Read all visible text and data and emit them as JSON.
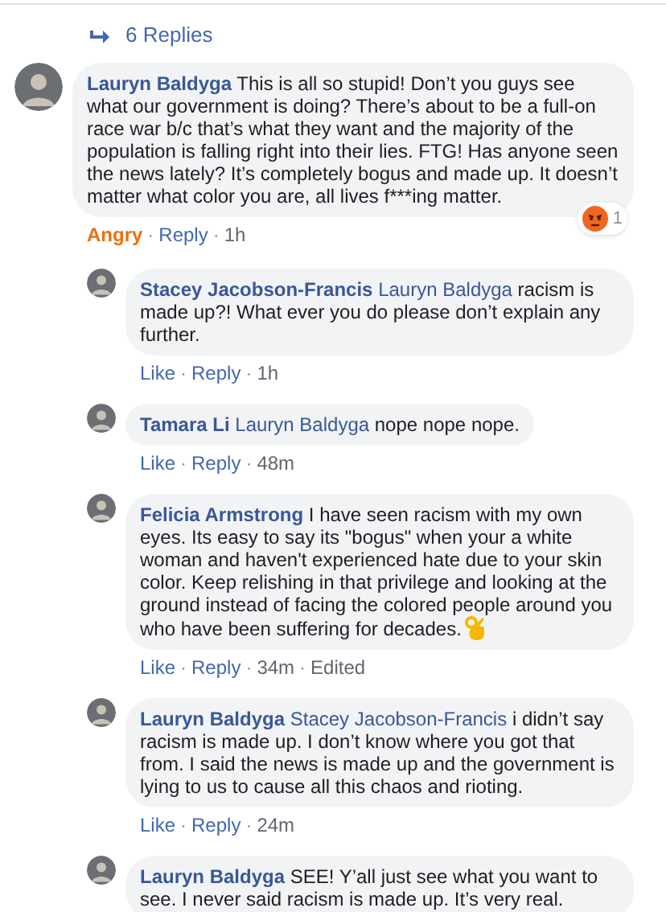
{
  "replies_link": {
    "label": "6 Replies"
  },
  "action_separator": "·",
  "comments": [
    {
      "author": "Lauryn Baldyga",
      "text": "This is all so stupid! Don’t you guys see what our government is doing? There’s about to be a full-on race war b/c that’s what they want and the majority of the population is falling right into their lies. FTG! Has anyone seen the news lately? It’s completely bogus and made up. It doesn’t matter what color you are, all lives f***ing matter.",
      "reply": false,
      "reaction": {
        "kind": "angry",
        "count": "1"
      },
      "actions": [
        {
          "label": "Angry",
          "kind": "reacted"
        },
        {
          "label": "Reply",
          "kind": "reply"
        },
        {
          "label": "1h",
          "kind": "time"
        }
      ]
    },
    {
      "author": "Stacey Jacobson-Francis",
      "mention": "Lauryn Baldyga",
      "text": "racism is made up?! What ever you do please don’t explain any further.",
      "reply": true,
      "actions": [
        {
          "label": "Like",
          "kind": "like"
        },
        {
          "label": "Reply",
          "kind": "reply"
        },
        {
          "label": "1h",
          "kind": "time"
        }
      ]
    },
    {
      "author": "Tamara Li",
      "mention": "Lauryn Baldyga",
      "text": "nope nope nope.",
      "reply": true,
      "actions": [
        {
          "label": "Like",
          "kind": "like"
        },
        {
          "label": "Reply",
          "kind": "reply"
        },
        {
          "label": "48m",
          "kind": "time"
        }
      ]
    },
    {
      "author": "Felicia Armstrong",
      "text": "I have seen racism with my own eyes. Its easy to say its \"bogus\" when your a white woman and haven't experienced hate due to your skin color. Keep relishing in that privilege and looking at the ground instead of facing the colored people around you who have been suffering for decades.",
      "ok_hand_emoji": true,
      "reply": true,
      "actions": [
        {
          "label": "Like",
          "kind": "like"
        },
        {
          "label": "Reply",
          "kind": "reply"
        },
        {
          "label": "34m",
          "kind": "time"
        },
        {
          "label": "Edited",
          "kind": "edited"
        }
      ]
    },
    {
      "author": "Lauryn Baldyga",
      "mention": "Stacey Jacobson-Francis",
      "text": "i didn’t say racism is made up. I don’t know where you got that from. I said the news is made up and the government is lying to us to cause all this chaos and rioting.",
      "reply": true,
      "actions": [
        {
          "label": "Like",
          "kind": "like"
        },
        {
          "label": "Reply",
          "kind": "reply"
        },
        {
          "label": "24m",
          "kind": "time"
        }
      ]
    },
    {
      "author": "Lauryn Baldyga",
      "text": "SEE! Y’all just see what you want to see. I never said racism is made up. It’s very real.",
      "reply": true
    }
  ]
}
